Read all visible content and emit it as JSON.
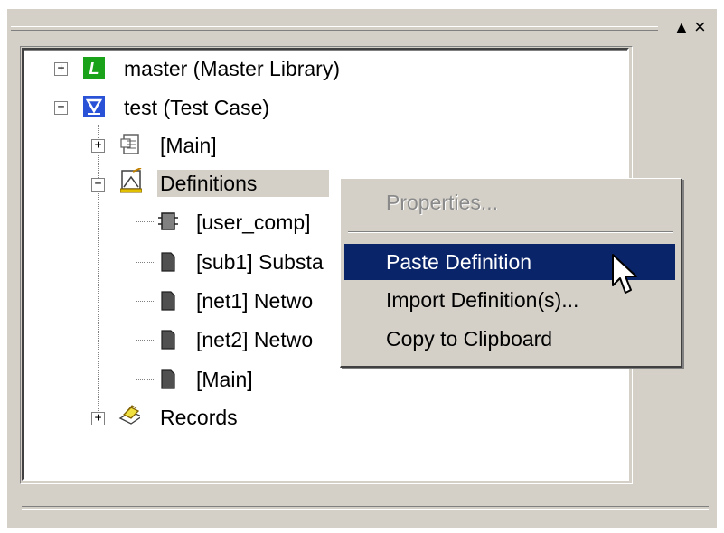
{
  "window": {
    "maximize_glyph": "▲",
    "close_glyph": "×"
  },
  "tree": {
    "items": [
      {
        "label": "master (Master Library)",
        "icon": "library-icon",
        "expander": "+"
      },
      {
        "label": "test (Test Case)",
        "icon": "testcase-icon",
        "expander": "−"
      },
      {
        "label": "[Main]",
        "icon": "module-icon",
        "expander": "+"
      },
      {
        "label": "Definitions",
        "icon": "definitions-icon",
        "expander": "−"
      },
      {
        "label": "[user_comp]",
        "icon": "component-icon"
      },
      {
        "label": "[sub1] Substa",
        "icon": "document-icon"
      },
      {
        "label": "[net1] Netwo",
        "icon": "document-icon"
      },
      {
        "label": "[net2] Netwo",
        "icon": "document-icon"
      },
      {
        "label": "[Main]",
        "icon": "document-icon"
      },
      {
        "label": "Records",
        "icon": "records-icon",
        "expander": "+"
      }
    ]
  },
  "context_menu": {
    "items": [
      {
        "label": "Properties...",
        "state": "disabled"
      },
      {
        "label": "Paste Definition",
        "state": "highlighted"
      },
      {
        "label": "Import Definition(s)...",
        "state": "normal"
      },
      {
        "label": "Copy to Clipboard",
        "state": "normal"
      }
    ]
  },
  "colors": {
    "panel": "#d4d0c8",
    "highlight": "#0a246a",
    "library_icon": "#1aa31a",
    "testcase_icon": "#2a52d6"
  }
}
